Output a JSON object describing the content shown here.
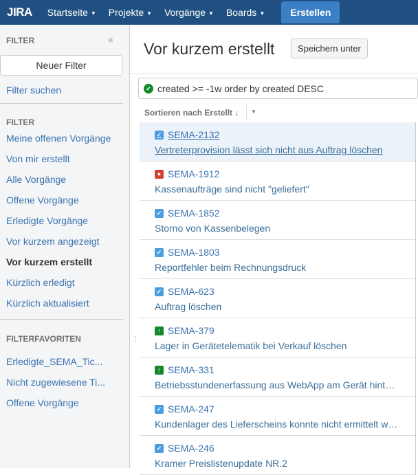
{
  "header": {
    "logo": "JIRA",
    "nav": [
      "Startseite",
      "Projekte",
      "Vorgänge",
      "Boards"
    ],
    "create": "Erstellen"
  },
  "sidebar": {
    "heading": "FILTER",
    "collapse": "«",
    "new_filter": "Neuer Filter",
    "search_filters": "Filter suchen",
    "filter_heading": "FILTER",
    "filters": [
      "Meine offenen Vorgänge",
      "Von mir erstellt",
      "Alle Vorgänge",
      "Offene Vorgänge",
      "Erledigte Vorgänge",
      "Vor kurzem angezeigt",
      "Vor kurzem erstellt",
      "Kürzlich erledigt",
      "Kürzlich aktualisiert"
    ],
    "fav_heading": "FILTERFAVORITEN",
    "favorites": [
      "Erledigte_SEMA_Tic...",
      "Nicht zugewiesene Ti...",
      "Offene Vorgänge"
    ]
  },
  "main": {
    "title": "Vor kurzem erstellt",
    "save_as": "Speichern unter",
    "query": "created >= -1w order by created DESC",
    "sort": "Sortieren nach Erstellt ↓",
    "issues": [
      {
        "key": "SEMA-2132",
        "type": "task",
        "summary": "Vertreterprovision lässt sich nicht aus Auftrag löschen"
      },
      {
        "key": "SEMA-1912",
        "type": "bug",
        "summary": "Kassenaufträge sind nicht \"geliefert\""
      },
      {
        "key": "SEMA-1852",
        "type": "task",
        "summary": "Storno von Kassenbelegen"
      },
      {
        "key": "SEMA-1803",
        "type": "task",
        "summary": "Reportfehler beim Rechnungsdruck"
      },
      {
        "key": "SEMA-623",
        "type": "task",
        "summary": "Auftrag löschen"
      },
      {
        "key": "SEMA-379",
        "type": "improvement",
        "summary": "Lager in Gerätetelematik bei Verkauf löschen"
      },
      {
        "key": "SEMA-331",
        "type": "improvement",
        "summary": "Betriebsstundenerfassung aus WebApp am Gerät hinterlegen"
      },
      {
        "key": "SEMA-247",
        "type": "task",
        "summary": "Kundenlager des Lieferscheins konnte nicht ermittelt werden"
      },
      {
        "key": "SEMA-246",
        "type": "task",
        "summary": "Kramer Preislistenupdate NR.2"
      }
    ]
  },
  "colors": {
    "header": "#205081",
    "task": "#4a9ee0",
    "bug": "#d04437",
    "improvement": "#14892c"
  }
}
